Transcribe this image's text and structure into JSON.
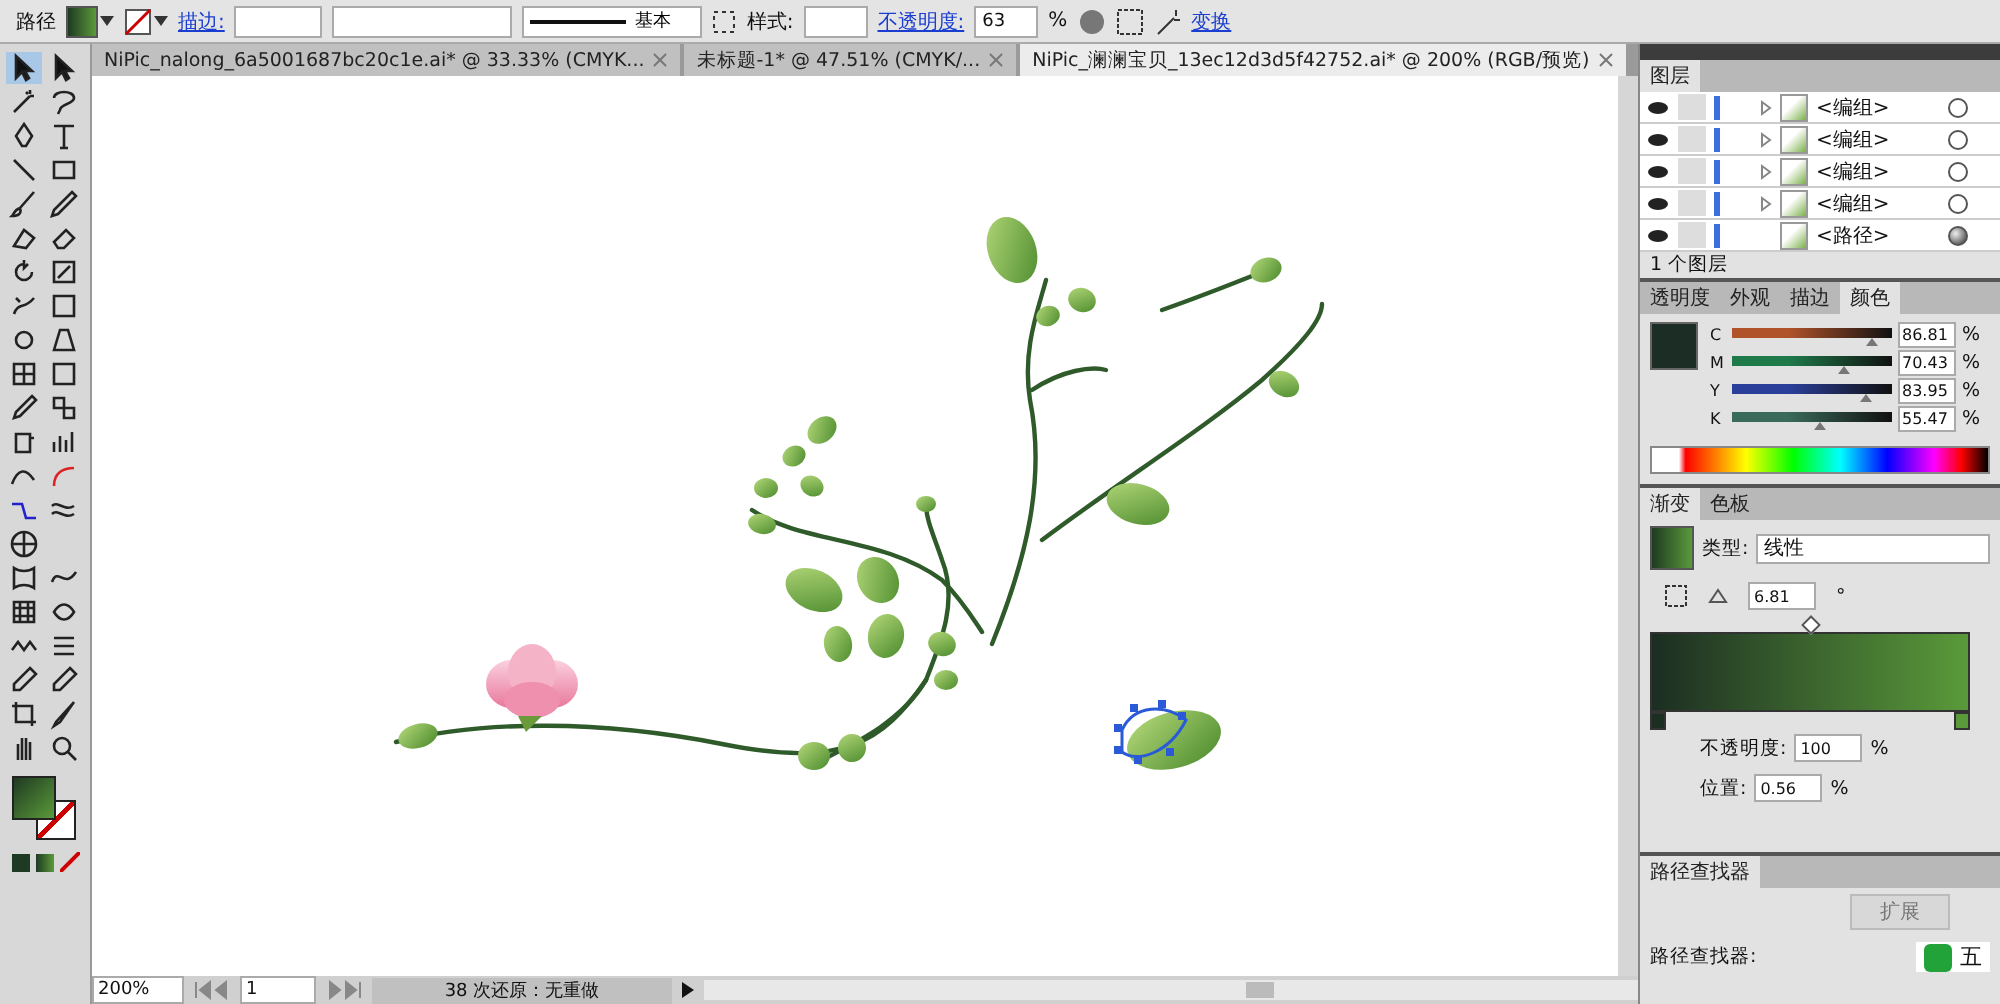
{
  "control_bar": {
    "object_type": "路径",
    "stroke_label": "描边:",
    "stroke_profile": "基本",
    "style_label": "样式:",
    "opacity_label": "不透明度:",
    "opacity_value": "63",
    "opacity_unit": "%",
    "transform_link": "变换"
  },
  "doc_tabs": [
    {
      "title": "NiPic_nalong_6a5001687bc20c1e.ai* @ 33.33% (CMYK...",
      "selected": false
    },
    {
      "title": "未标题-1* @ 47.51% (CMYK/...",
      "selected": false
    },
    {
      "title": "NiPic_澜澜宝贝_13ec12d3d5f42752.ai* @ 200% (RGB/预览)",
      "selected": true
    }
  ],
  "layers_panel": {
    "tab": "图层",
    "rows": [
      {
        "name": "<编组>",
        "expandable": true,
        "targeted": false
      },
      {
        "name": "<编组>",
        "expandable": true,
        "targeted": false
      },
      {
        "name": "<编组>",
        "expandable": true,
        "targeted": false
      },
      {
        "name": "<编组>",
        "expandable": true,
        "targeted": false
      },
      {
        "name": "<路径>",
        "expandable": false,
        "targeted": true
      }
    ],
    "count": "1 个图层"
  },
  "color_panel": {
    "tabs": [
      {
        "label": "透明度",
        "selected": false
      },
      {
        "label": "外观",
        "selected": false
      },
      {
        "label": "描边",
        "selected": false
      },
      {
        "label": "颜色",
        "selected": true
      }
    ],
    "channels": [
      {
        "name": "C",
        "value": "86.81",
        "unit": "%",
        "level": 0.87,
        "color": "#b0522a"
      },
      {
        "name": "M",
        "value": "70.43",
        "unit": "%",
        "level": 0.7,
        "color": "#1f7a4a"
      },
      {
        "name": "Y",
        "value": "83.95",
        "unit": "%",
        "level": 0.84,
        "color": "#2a3f9a"
      },
      {
        "name": "K",
        "value": "55.47",
        "unit": "%",
        "level": 0.55,
        "color": "#3a6a5a"
      }
    ]
  },
  "gradient_panel": {
    "tabs": [
      {
        "label": "渐变",
        "selected": true
      },
      {
        "label": "色板",
        "selected": false
      }
    ],
    "type_label": "类型:",
    "type_value": "线性",
    "angle": "6.81",
    "angle_unit": "°",
    "midpoint": {
      "level": 0.5
    },
    "opacity_label": "不透明度:",
    "opacity_value": "100",
    "opacity_unit": "%",
    "position_label": "位置:",
    "position_value": "0.56",
    "position_unit": "%"
  },
  "pathfinder_panel": {
    "tab": "路径查找器",
    "expand_button": "扩展",
    "pathfinders_label": "路径查找器:"
  },
  "status_bar": {
    "zoom": "200%",
    "page": "1",
    "status": "38 次还原：无重做"
  },
  "ime_bar": {
    "mode": "五"
  }
}
